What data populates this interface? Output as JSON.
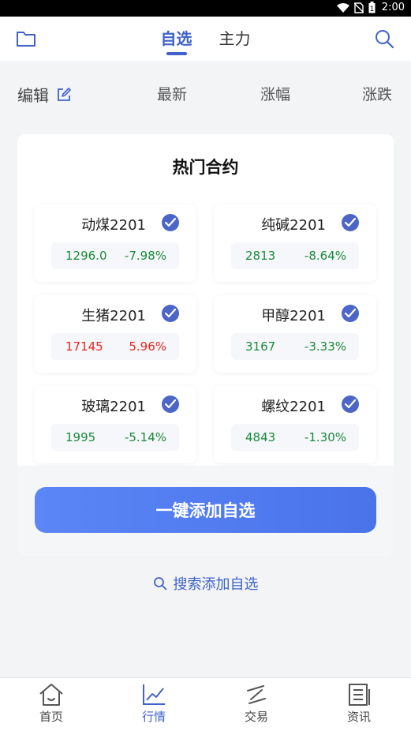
{
  "status_bar": {
    "time": "2:00",
    "icons": [
      "wifi-icon",
      "no-sim-icon",
      "battery-icon"
    ]
  },
  "top_nav": {
    "tabs": [
      {
        "label": "自选",
        "active": true
      },
      {
        "label": "主力",
        "active": false
      }
    ],
    "left_icon": "folder-icon",
    "right_icon": "search-icon"
  },
  "column_header": {
    "edit_label": "编辑",
    "columns": [
      "最新",
      "涨幅",
      "涨跌"
    ]
  },
  "hot_contracts": {
    "title": "热门合约",
    "cards": [
      {
        "name": "动煤2201",
        "price": "1296.0",
        "change": "-7.98%",
        "direction": "down",
        "checked": true
      },
      {
        "name": "纯碱2201",
        "price": "2813",
        "change": "-8.64%",
        "direction": "down",
        "checked": true
      },
      {
        "name": "生猪2201",
        "price": "17145",
        "change": "5.96%",
        "direction": "up",
        "checked": true
      },
      {
        "name": "甲醇2201",
        "price": "3167",
        "change": "-3.33%",
        "direction": "down",
        "checked": true
      },
      {
        "name": "玻璃2201",
        "price": "1995",
        "change": "-5.14%",
        "direction": "down",
        "checked": true
      },
      {
        "name": "螺纹2201",
        "price": "4843",
        "change": "-1.30%",
        "direction": "down",
        "checked": true
      }
    ],
    "add_all_label": "一键添加自选",
    "search_add_label": "搜索添加自选"
  },
  "bottom_nav": [
    {
      "label": "首页",
      "icon": "home-icon",
      "active": false
    },
    {
      "label": "行情",
      "icon": "chart-trend-icon",
      "active": true
    },
    {
      "label": "交易",
      "icon": "trade-icon",
      "active": false
    },
    {
      "label": "资讯",
      "icon": "news-icon",
      "active": false
    }
  ],
  "colors": {
    "accent": "#3f63c8",
    "up": "#e8251f",
    "down": "#1a8a3a",
    "button_gradient_start": "#5a86f6",
    "button_gradient_end": "#4a73ea"
  }
}
